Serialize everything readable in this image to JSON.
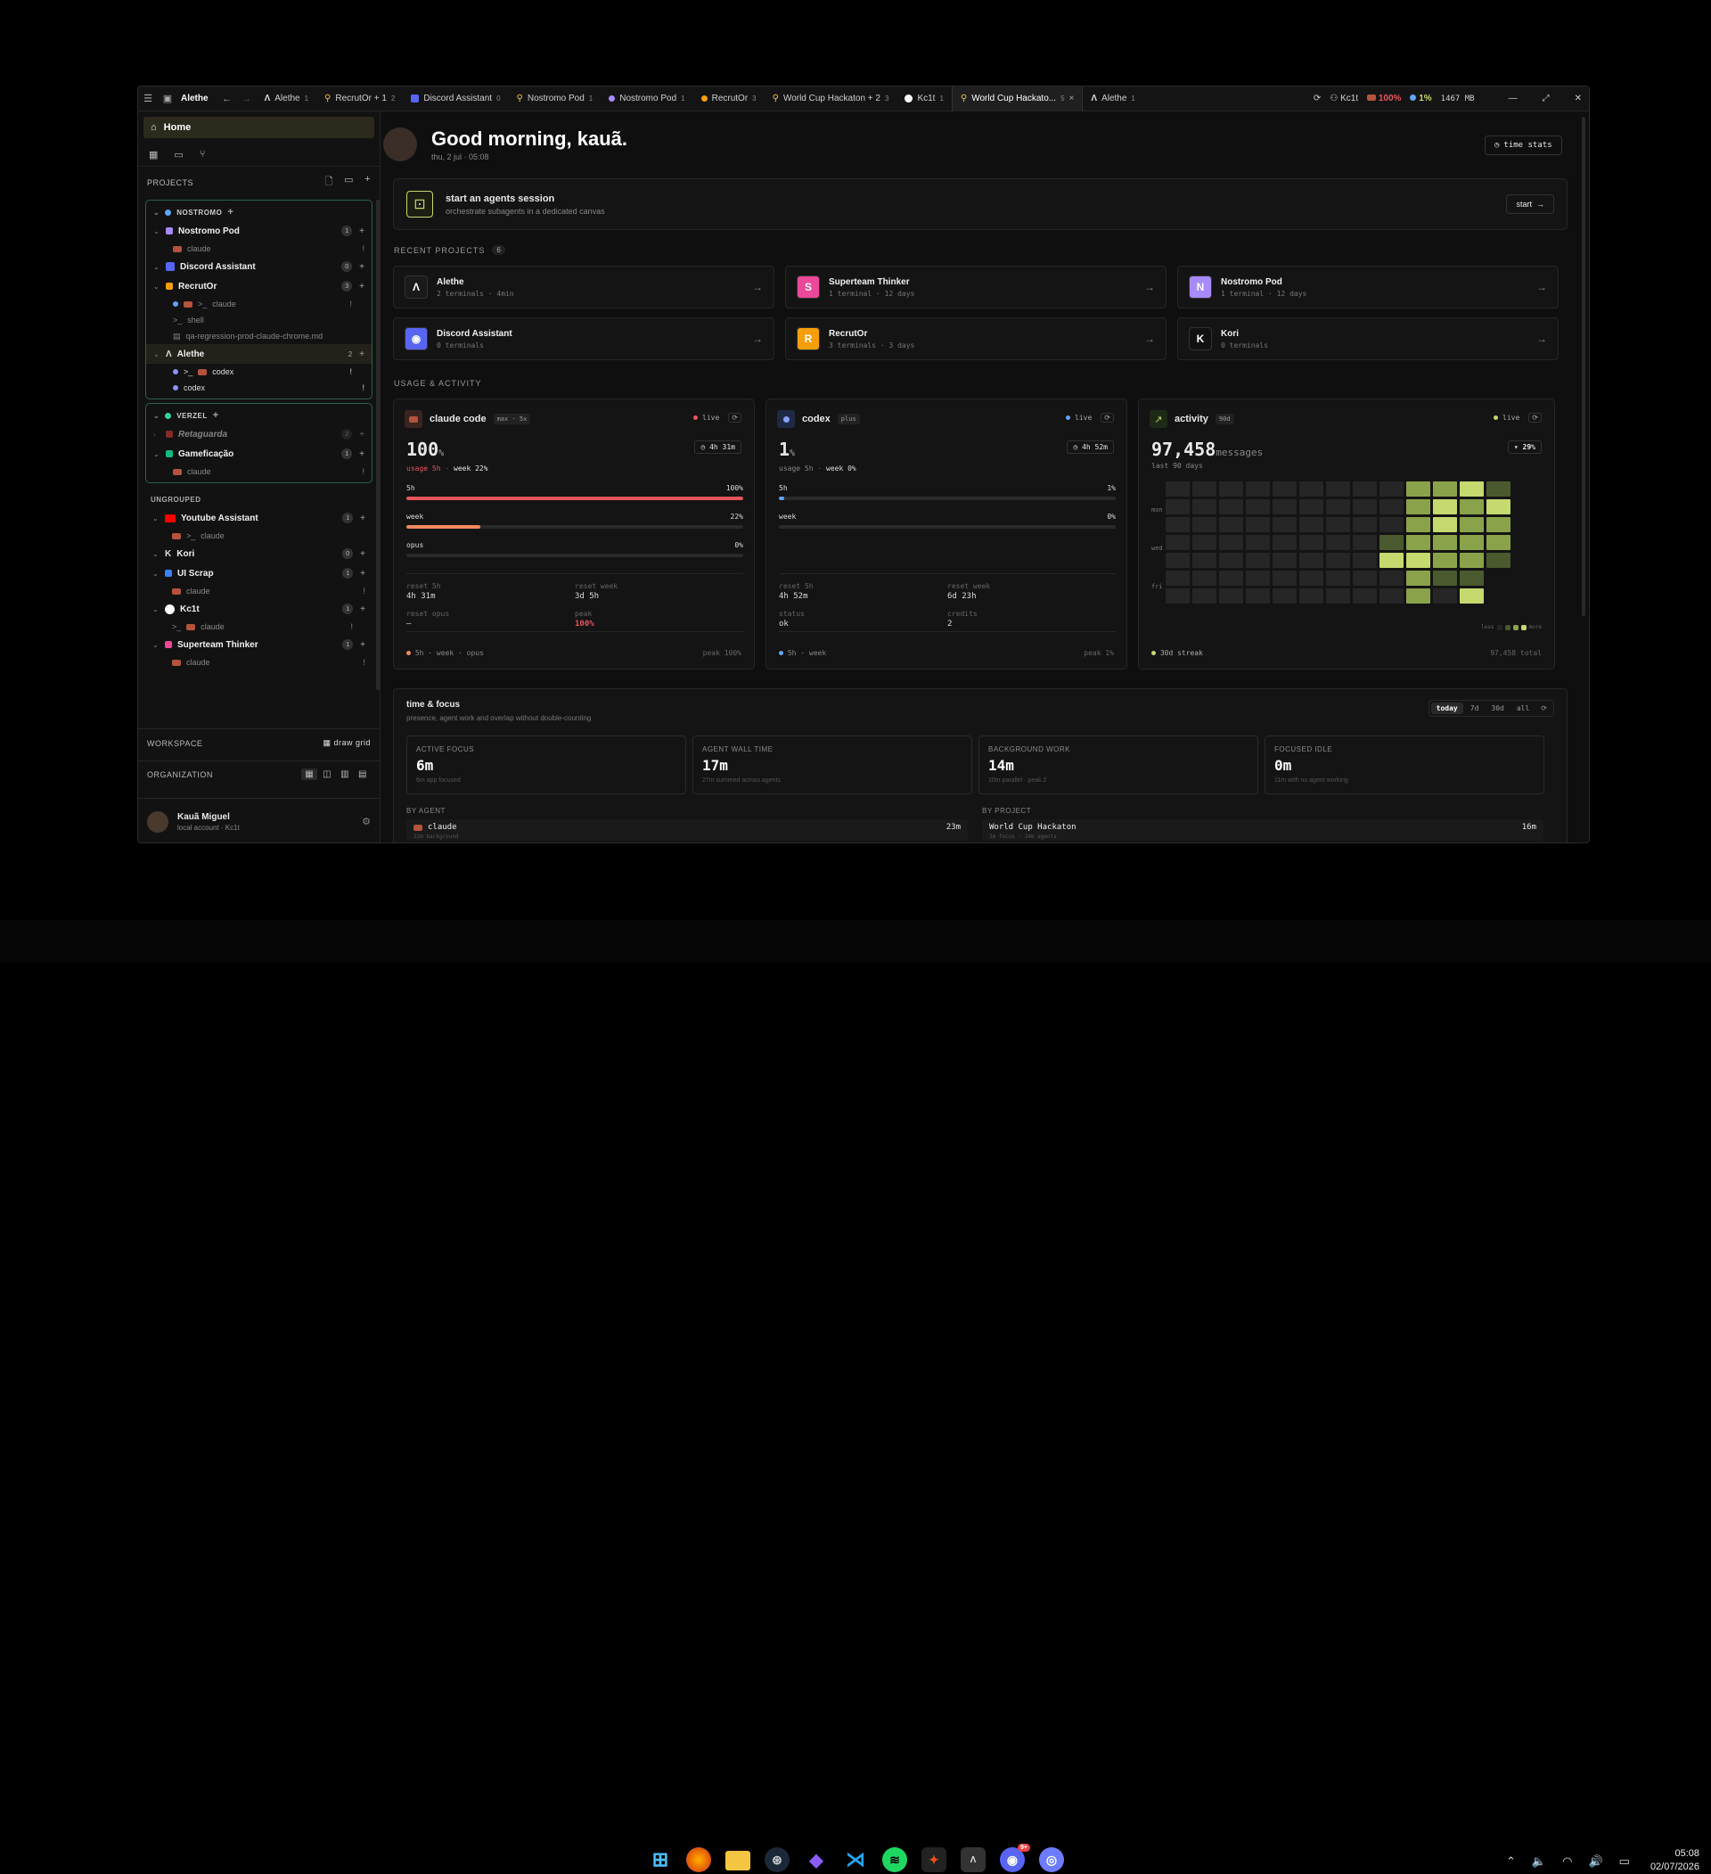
{
  "tabbar": {
    "brand": "Alethe",
    "tabs": [
      {
        "label": "Alethe",
        "count": "1",
        "icon": "alethe-icon",
        "color": "#dddddd"
      },
      {
        "label": "RecrutOr + 1",
        "count": "2",
        "icon": "folder-link-icon",
        "color": "#e6c84a"
      },
      {
        "label": "Discord Assistant",
        "count": "0",
        "icon": "discord-icon",
        "color": "#5865f2"
      },
      {
        "label": "Nostromo Pod",
        "count": "1",
        "icon": "folder-link-icon",
        "color": "#e6c84a"
      },
      {
        "label": "Nostromo Pod",
        "count": "1",
        "icon": "dot-icon",
        "color": "#a78bfa"
      },
      {
        "label": "RecrutOr",
        "count": "3",
        "icon": "dot-icon",
        "color": "#f59e0b"
      },
      {
        "label": "World Cup Hackaton + 2",
        "count": "3",
        "icon": "folder-link-icon",
        "color": "#e6c84a"
      },
      {
        "label": "Kc1t",
        "count": "1",
        "icon": "kc1t-icon",
        "color": "#ffffff"
      },
      {
        "label": "World Cup Hackato...",
        "count": "5",
        "icon": "folder-link-icon",
        "color": "#e6c84a",
        "active": true
      },
      {
        "label": "Alethe",
        "count": "1",
        "icon": "alethe-icon",
        "color": "#dddddd"
      }
    ],
    "user": "Kc1t",
    "claude_usage": "100%",
    "codex_usage": "1%",
    "memory": "1467 MB"
  },
  "sidebar": {
    "home": "Home",
    "projects_label": "PROJECTS",
    "nostromo": {
      "label": "NOSTROMO",
      "color": "#60a5fa"
    },
    "verzel": {
      "label": "VERZEL",
      "color": "#34d399"
    },
    "ungrouped_label": "UNGROUPED",
    "p": {
      "nostromo_pod": {
        "name": "Nostromo Pod",
        "count": "1",
        "color": "#a78bfa"
      },
      "discord": {
        "name": "Discord Assistant",
        "count": "0",
        "color": "#5865f2"
      },
      "recrutor": {
        "name": "RecrutOr",
        "count": "3",
        "color": "#f59e0b"
      },
      "alethe": {
        "name": "Alethe",
        "count": "2"
      },
      "retaguarda": {
        "name": "Retaguarda",
        "count": "2",
        "color": "#ef4444"
      },
      "gamificacao": {
        "name": "Gameficação",
        "count": "1",
        "color": "#10b981"
      },
      "youtube": {
        "name": "Youtube Assistant",
        "count": "1"
      },
      "kori": {
        "name": "Kori",
        "count": "0"
      },
      "uiscrap": {
        "name": "UI Scrap",
        "count": "1",
        "color": "#3b82f6"
      },
      "kc1t": {
        "name": "Kc1t",
        "count": "1"
      },
      "superteam": {
        "name": "Superteam Thinker",
        "count": "1",
        "color": "#ec4899"
      }
    },
    "s": {
      "claude": "claude",
      "shell": "shell",
      "file": "qa-regression-prod-claude-chrome.md",
      "codex": "codex",
      "term_prefix": ">_"
    },
    "workspace_label": "WORKSPACE",
    "draw_grid": "draw grid",
    "org_label": "ORGANIZATION",
    "user_name": "Kauã Miguel",
    "user_sub": "local account · Kc1t"
  },
  "header": {
    "greeting": "Good morning, kauã.",
    "date": "thu, 2 jul · 05:08",
    "time_stats": "time stats"
  },
  "session": {
    "title": "start an agents session",
    "sub": "orchestrate subagents in a dedicated canvas",
    "start": "start"
  },
  "recent": {
    "label": "RECENT PROJECTS",
    "count": "6",
    "items": [
      {
        "name": "Alethe",
        "sub": "2 terminals · 4min",
        "letter": "Λ",
        "color": "#1a1a1a",
        "icon": "alethe-logo-icon"
      },
      {
        "name": "Superteam Thinker",
        "sub": "1 terminal · 12 days",
        "letter": "S",
        "color": "#ec4899",
        "icon": "s-avatar-icon"
      },
      {
        "name": "Nostromo Pod",
        "sub": "1 terminal · 12 days",
        "letter": "N",
        "color": "#a78bfa",
        "icon": "n-avatar-icon"
      },
      {
        "name": "Discord Assistant",
        "sub": "0 terminals",
        "letter": "◉",
        "color": "#5865f2",
        "icon": "discord-icon"
      },
      {
        "name": "RecrutOr",
        "sub": "3 terminals · 3 days",
        "letter": "R",
        "color": "#f59e0b",
        "icon": "r-avatar-icon"
      },
      {
        "name": "Kori",
        "sub": "0 terminals",
        "letter": "K",
        "color": "#111111",
        "icon": "kori-logo-icon"
      }
    ]
  },
  "usage": {
    "label": "USAGE & ACTIVITY",
    "claude": {
      "title": "claude code",
      "plan": "max · 5x",
      "live": "live",
      "value": "100",
      "unit": "%",
      "timer": "4h 31m",
      "usage_5h": "usage 5h",
      "sep": "·",
      "week": "week 22%",
      "bars": [
        {
          "name": "5h",
          "pct": "100%",
          "fill": 1.0,
          "color": "#e8555e"
        },
        {
          "name": "week",
          "pct": "22%",
          "fill": 0.22,
          "color": "#f08a5d"
        },
        {
          "name": "opus",
          "pct": "0%",
          "fill": 0,
          "color": "#888888"
        }
      ],
      "stats": [
        {
          "k": "reset 5h",
          "v": "4h 31m"
        },
        {
          "k": "reset week",
          "v": "3d 5h"
        },
        {
          "k": "reset opus",
          "v": "–"
        },
        {
          "k": "peak",
          "v": "100%",
          "red": true
        }
      ],
      "footer": "5h · week · opus",
      "peak": "peak 100%"
    },
    "codex": {
      "title": "codex",
      "plan": "plus",
      "live": "live",
      "value": "1",
      "unit": "%",
      "timer": "4h 52m",
      "usage_5h": "usage 5h",
      "sep": "·",
      "week": "week 0%",
      "bars": [
        {
          "name": "5h",
          "pct": "1%",
          "fill": 0.01,
          "color": "#60a5fa"
        },
        {
          "name": "week",
          "pct": "0%",
          "fill": 0,
          "color": "#60a5fa"
        }
      ],
      "stats": [
        {
          "k": "reset 5h",
          "v": "4h 52m"
        },
        {
          "k": "reset week",
          "v": "6d 23h"
        },
        {
          "k": "status",
          "v": "ok"
        },
        {
          "k": "credits",
          "v": "2"
        }
      ],
      "footer": "5h · week",
      "peak": "peak 1%"
    },
    "activity": {
      "title": "activity",
      "range": "90d",
      "live": "live",
      "value": "97,458",
      "unit": "messages",
      "sub": "last 90 days",
      "delta": "▾ 29%",
      "days": [
        "mon",
        "wed",
        "fri"
      ],
      "less": "less",
      "more": "more",
      "streak": "30d streak",
      "total": "97,458 total"
    }
  },
  "time": {
    "title": "time & focus",
    "sub": "presence, agent work and overlap without double-counting",
    "ranges": [
      "today",
      "7d",
      "30d",
      "all"
    ],
    "cards": [
      {
        "k": "ACTIVE FOCUS",
        "v": "6m",
        "s": "6m app focused"
      },
      {
        "k": "AGENT WALL TIME",
        "v": "17m",
        "s": "27m summed across agents"
      },
      {
        "k": "BACKGROUND WORK",
        "v": "14m",
        "s": "10m parallel · peak 2"
      },
      {
        "k": "FOCUSED IDLE",
        "v": "0m",
        "s": "11m with no agent working"
      }
    ],
    "by_agent": "BY AGENT",
    "by_project": "BY PROJECT",
    "agent_row": {
      "name": "claude",
      "sub": "22m background",
      "v": "23m"
    },
    "project_row": {
      "name": "World Cup Hackaton",
      "sub": "2m focus · 24m agents",
      "v": "16m"
    }
  },
  "system": {
    "time": "05:08",
    "date": "02/07/2026",
    "discord_badge": "9+"
  },
  "colors": {
    "accent": "#c4d96e",
    "claude": "#e8555e",
    "codex": "#60a5fa"
  }
}
